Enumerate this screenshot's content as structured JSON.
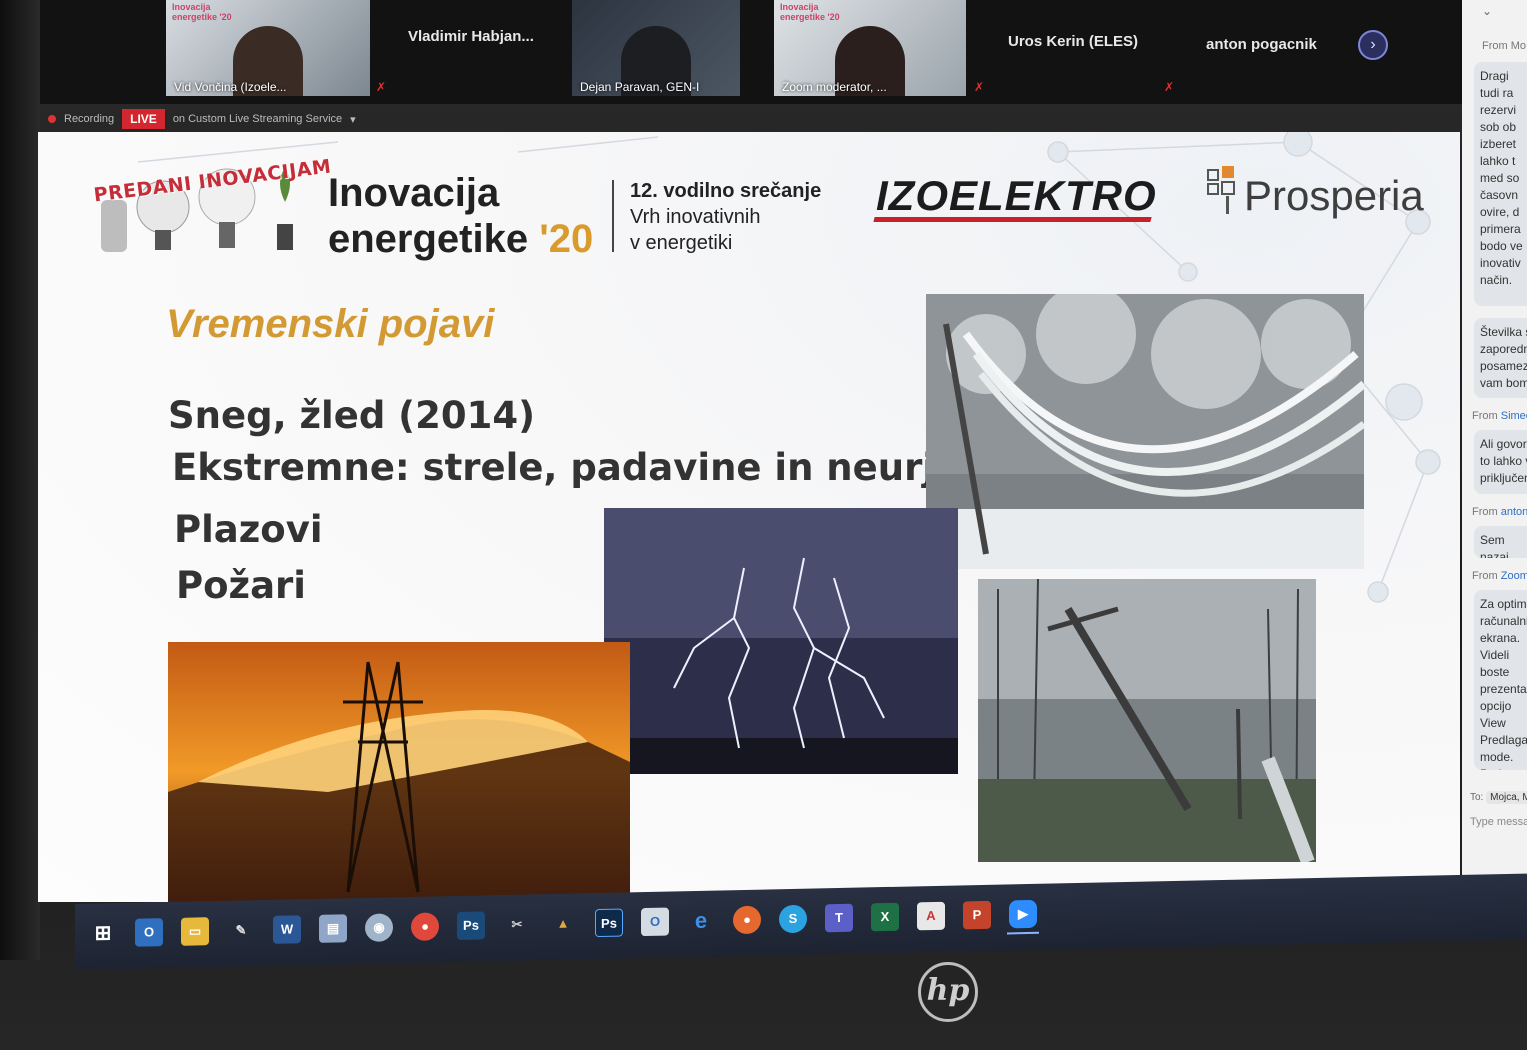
{
  "participants": [
    {
      "name": "Vid Vončina (Izoele...",
      "slide_mini": "Inovacija energetike '20"
    },
    {
      "name": "Vladimir Habjan..."
    },
    {
      "name": "Dejan Paravan, GEN-I"
    },
    {
      "name": "Zoom moderator, ...",
      "slide_mini": "Inovacija energetike '20"
    },
    {
      "name": "Uros Kerin (ELES)"
    },
    {
      "name": "anton pogacnik"
    }
  ],
  "next_arrow_icon": "chevron-right-icon",
  "recording": {
    "label": "Recording",
    "live_badge": "LIVE",
    "stream_label": "on Custom Live Streaming Service"
  },
  "slide": {
    "slogan": "PREDANI INOVACIJAM",
    "brand_line1": "Inovacija",
    "brand_line2": "energetike",
    "brand_year": "'20",
    "event_line1": "12. vodilno srečanje",
    "event_line2": "Vrh inovativnih",
    "event_line3": "v energetiki",
    "sponsor1": "IZOELEKTRO",
    "sponsor2": "Prosperia",
    "heading": "Vremenski pojavi",
    "bullets": [
      "Sneg, žled (2014)",
      "Ekstremne: strele, padavine in neurja",
      "Plazovi",
      "Požari"
    ]
  },
  "chat": {
    "top_label": "From Mo",
    "messages": [
      {
        "from_prefix": "",
        "from": "",
        "text": "Dragi\ntudi ra\nrezervi\nsob ob\nizberet\nlahko t\nmed so\nčasovn\novire, d\nprimera\nbodo ve\ninovativ\nnačin."
      },
      {
        "from_prefix": "",
        "from": "",
        "text": "Številka s\nzaporedn\nposamez\nvam bom"
      },
      {
        "from_prefix": "From",
        "from": "Simeon",
        "text": "Ali govori\nto lahko v\npriključeni"
      },
      {
        "from_prefix": "From",
        "from": "anton p",
        "text": "Sem nazaj,"
      },
      {
        "from_prefix": "From",
        "from": "Zoom m",
        "text": "Za optimal\nračunalniku\nekrana.\nVideli boste\nprezentator\nopcijo View\nPredlagam,\nmode.\nPod \"Zoom\nprimerno vel"
      }
    ],
    "to_label": "To:",
    "to_value": "Mojca, MOD",
    "type_placeholder": "Type message he"
  },
  "taskbar_icons": [
    "windows-start-icon",
    "outlook-icon",
    "file-explorer-icon",
    "pen-icon",
    "word-icon",
    "notepad-icon",
    "app-icon",
    "chrome-icon",
    "photoshop-icon",
    "app-tool-icon",
    "matlab-icon",
    "photoshop-icon",
    "outlook-icon",
    "edge-icon",
    "firefox-icon",
    "skype-icon",
    "teams-icon",
    "excel-icon",
    "acrobat-icon",
    "powerpoint-icon",
    "zoom-icon"
  ],
  "hp_logo": "hp",
  "colors": {
    "accent_gold": "#d39a34",
    "live_red": "#d3272f",
    "izo_red": "#c7212b",
    "taskbar": "#283042"
  }
}
